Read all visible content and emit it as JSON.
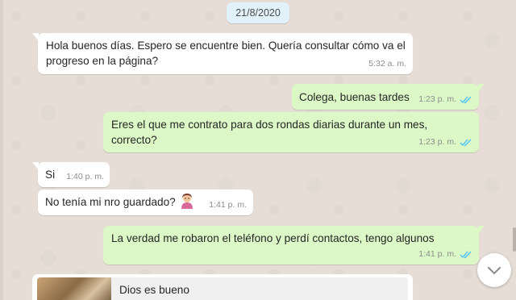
{
  "date_chip": "21/8/2020",
  "messages": [
    {
      "direction": "in",
      "lines": [
        "Hola buenos días. Espero se encuentre bien. Quería consultar cómo va el",
        "progreso en la página?"
      ],
      "time": "5:32 a. m."
    },
    {
      "direction": "out",
      "lines": [
        "Colega, buenas tardes"
      ],
      "time": "1:23 p. m.",
      "status": "read"
    },
    {
      "direction": "out",
      "lines": [
        "Eres el que me contrato para dos rondas diarias durante un mes,",
        "correcto?"
      ],
      "time": "1:23 p. m.",
      "status": "read"
    },
    {
      "direction": "in",
      "lines": [
        "Si"
      ],
      "time": "1:40 p. m."
    },
    {
      "direction": "in",
      "lines": [
        "No tenía mi nro guardado?"
      ],
      "time": "1:41 p. m.",
      "emoji": "woman-tipping-hand-emoji"
    },
    {
      "direction": "out",
      "lines": [
        "La verdad me robaron el teléfono y perdí contactos, tengo algunos"
      ],
      "time": "1:41 p. m.",
      "status": "read"
    }
  ],
  "link_preview": {
    "title": "Dios es bueno"
  },
  "icons": {
    "scroll_down": "chevron-down-icon",
    "read_receipt": "double-check-icon"
  },
  "colors": {
    "incoming_bubble": "#ffffff",
    "outgoing_bubble": "#dcf8c6",
    "read_ticks": "#4fc3f7",
    "date_chip": "#e1f2fb",
    "background": "#e6ded6"
  }
}
